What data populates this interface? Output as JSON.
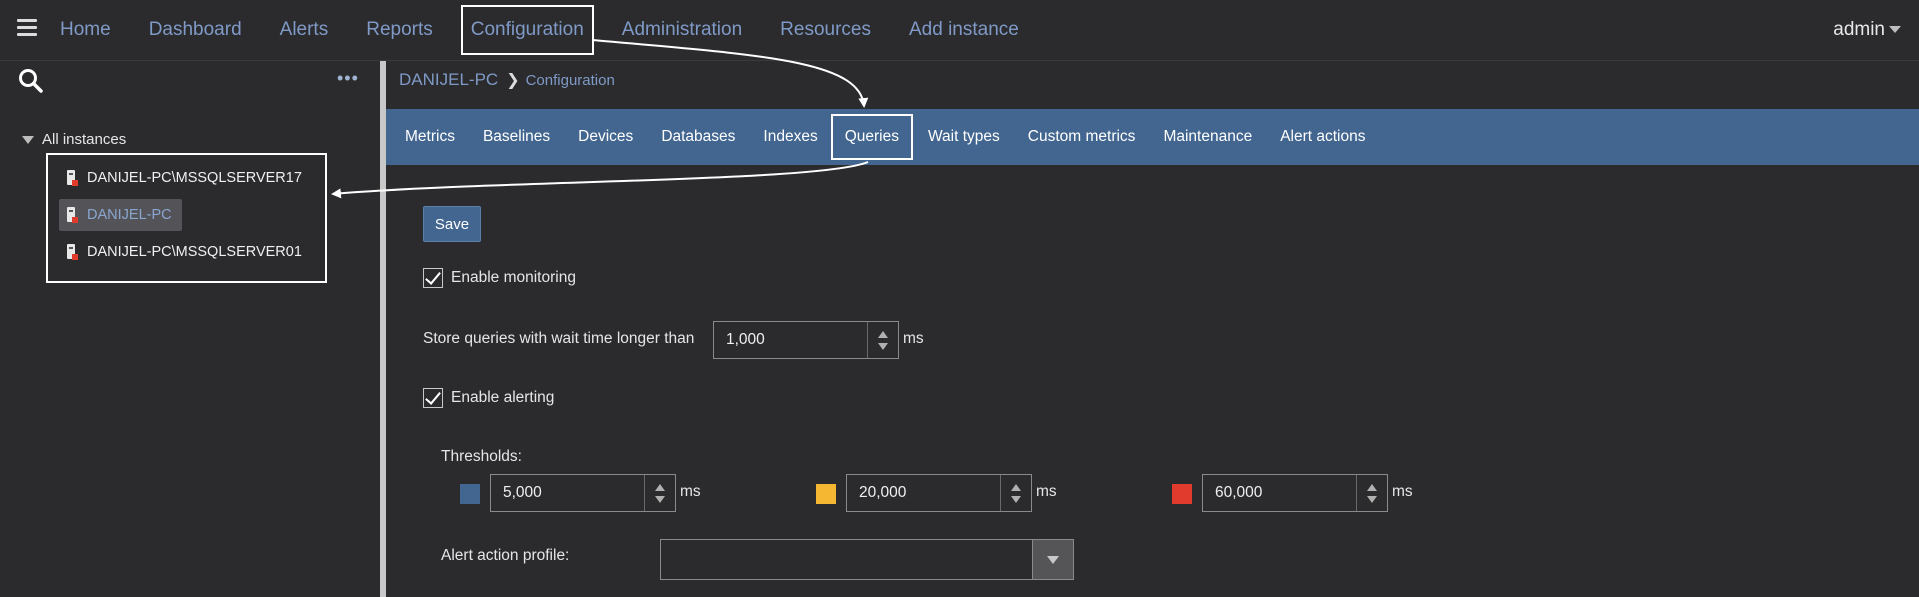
{
  "topnav": {
    "items": [
      "Home",
      "Dashboard",
      "Alerts",
      "Reports",
      "Configuration",
      "Administration",
      "Resources",
      "Add instance"
    ],
    "user": "admin"
  },
  "sidebar": {
    "root_label": "All instances",
    "instances": [
      "DANIJEL-PC\\MSSQLSERVER17",
      "DANIJEL-PC",
      "DANIJEL-PC\\MSSQLSERVER01"
    ],
    "selected": "DANIJEL-PC"
  },
  "breadcrumb": {
    "instance": "DANIJEL-PC",
    "current": "Configuration"
  },
  "tabs": [
    "Metrics",
    "Baselines",
    "Devices",
    "Databases",
    "Indexes",
    "Queries",
    "Wait types",
    "Custom metrics",
    "Maintenance",
    "Alert actions"
  ],
  "active_tab": "Queries",
  "form": {
    "save_label": "Save",
    "enable_monitoring_label": "Enable monitoring",
    "enable_monitoring_checked": true,
    "store_label": "Store queries with wait time longer than",
    "store_value": "1,000",
    "unit": "ms",
    "enable_alerting_label": "Enable alerting",
    "enable_alerting_checked": true,
    "thresholds_label": "Thresholds:",
    "thresholds": [
      {
        "value": "5,000",
        "color": "#42668f"
      },
      {
        "value": "20,000",
        "color": "#f5b731"
      },
      {
        "value": "60,000",
        "color": "#e03b2d"
      }
    ],
    "alert_profile_label": "Alert action profile:",
    "alert_profile_value": ""
  },
  "colors": {
    "background": "#2b2b2e",
    "tabbar": "#42668f",
    "link": "#7f9ac6"
  }
}
